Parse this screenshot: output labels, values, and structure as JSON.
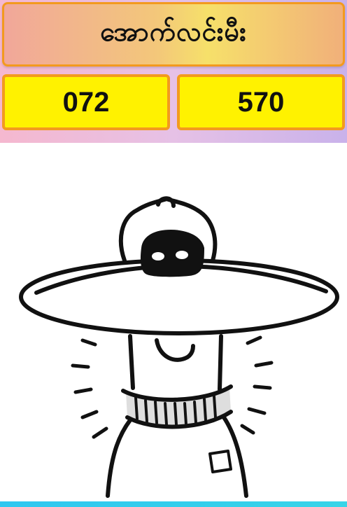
{
  "header": {
    "title": "အောက်လင်းမီး"
  },
  "numbers": {
    "left": "072",
    "right": "570"
  },
  "colors": {
    "number_box_fill": "#fff200",
    "border_accent": "#f39a1e",
    "bottom_bar": "#2ec7f0"
  }
}
